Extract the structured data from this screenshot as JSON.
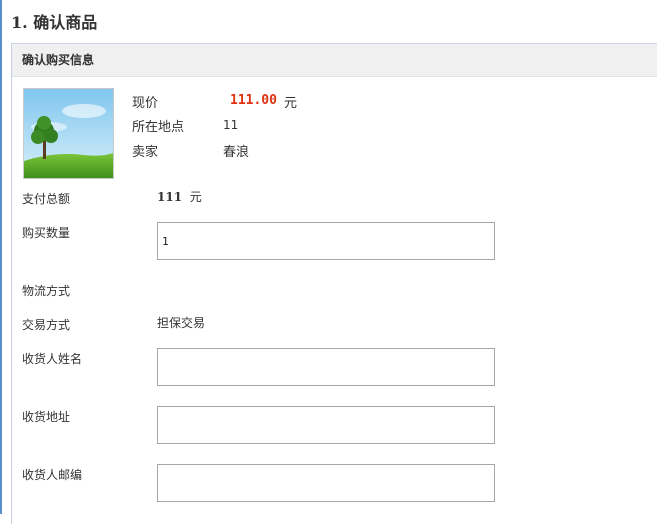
{
  "step_title": "1. 确认商品",
  "panel_title": "确认购买信息",
  "product": {
    "price_label": "现价",
    "price_value": "111.00",
    "price_unit": "元",
    "location_label": "所在地点",
    "location_value": "11",
    "seller_label": "卖家",
    "seller_value": "春浪"
  },
  "form": {
    "total_label": "支付总额",
    "total_value": "111",
    "total_unit": "元",
    "quantity_label": "购买数量",
    "quantity_value": "1",
    "shipping_label": "物流方式",
    "trade_label": "交易方式",
    "trade_value": "担保交易",
    "receiver_name_label": "收货人姓名",
    "receiver_name_value": "",
    "address_label": "收货地址",
    "address_value": "",
    "zipcode_label": "收货人邮编",
    "zipcode_value": ""
  },
  "colors": {
    "price": "#e03010",
    "accent_rule": "#5b8fc7"
  },
  "image": {
    "icon": "tree-landscape-image"
  }
}
